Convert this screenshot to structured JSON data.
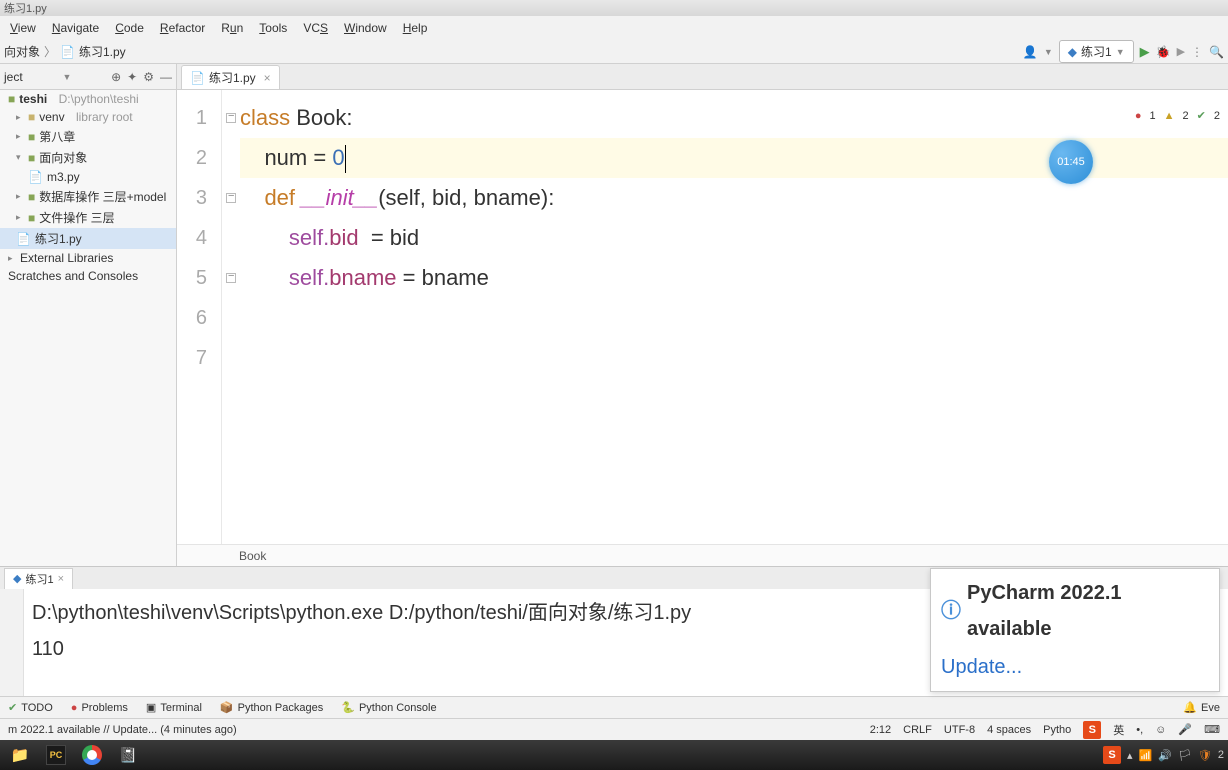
{
  "titlebar": {
    "filename": "练习1.py"
  },
  "menu": {
    "view": "View",
    "navigate": "Navigate",
    "code": "Code",
    "refactor": "Refactor",
    "run": "Run",
    "tools": "Tools",
    "vcs": "VCS",
    "window": "Window",
    "help": "Help"
  },
  "breadcrumb": {
    "p1": "向对象",
    "p2": "练习1.py"
  },
  "runConfig": {
    "name": "练习1"
  },
  "sidebar": {
    "title": "ject",
    "items": [
      {
        "label": "teshi",
        "path": "D:\\python\\teshi"
      },
      {
        "label": "venv",
        "hint": "library root"
      },
      {
        "label": "第八章"
      },
      {
        "label": "面向对象"
      },
      {
        "label": "m3.py"
      },
      {
        "label": "数据库操作 三层+model"
      },
      {
        "label": "文件操作 三层"
      },
      {
        "label": "练习1.py"
      },
      {
        "label": "External Libraries"
      },
      {
        "label": "Scratches and Consoles"
      }
    ]
  },
  "editor": {
    "tab": "练习1.py",
    "lines": [
      "1",
      "2",
      "3",
      "4",
      "5",
      "6",
      "7"
    ],
    "code": {
      "l1a": "class ",
      "l1b": "Book:",
      "l2a": "    num = ",
      "l2b": "0",
      "l3a": "    def ",
      "l3b": "__init__",
      "l3c": "(self, bid, bname):",
      "l4a": "        self.",
      "l4b": "bid",
      "l4c": "  = bid",
      "l5a": "        self.",
      "l5b": "bname",
      "l5c": " = bname"
    },
    "breadcrumb": "Book",
    "inspections": {
      "errors": "1",
      "warnings": "2",
      "typos": "2"
    },
    "timer": "01:45"
  },
  "runPanel": {
    "tab": "练习1",
    "line1": "D:\\python\\teshi\\venv\\Scripts\\python.exe D:/python/teshi/面向对象/练习1.py",
    "line2": "110"
  },
  "notification": {
    "title": "PyCharm 2022.1 available",
    "link": "Update..."
  },
  "toolwindows": {
    "todo": "TODO",
    "problems": "Problems",
    "terminal": "Terminal",
    "pypkg": "Python Packages",
    "pyconsole": "Python Console",
    "eventlog": "Eve"
  },
  "statusbar": {
    "left": "m 2022.1 available // Update... (4 minutes ago)",
    "pos": "2:12",
    "sep": "CRLF",
    "enc": "UTF-8",
    "indent": "4 spaces",
    "lang": "Pytho",
    "ime": "英"
  },
  "tray": {
    "time": "2"
  }
}
